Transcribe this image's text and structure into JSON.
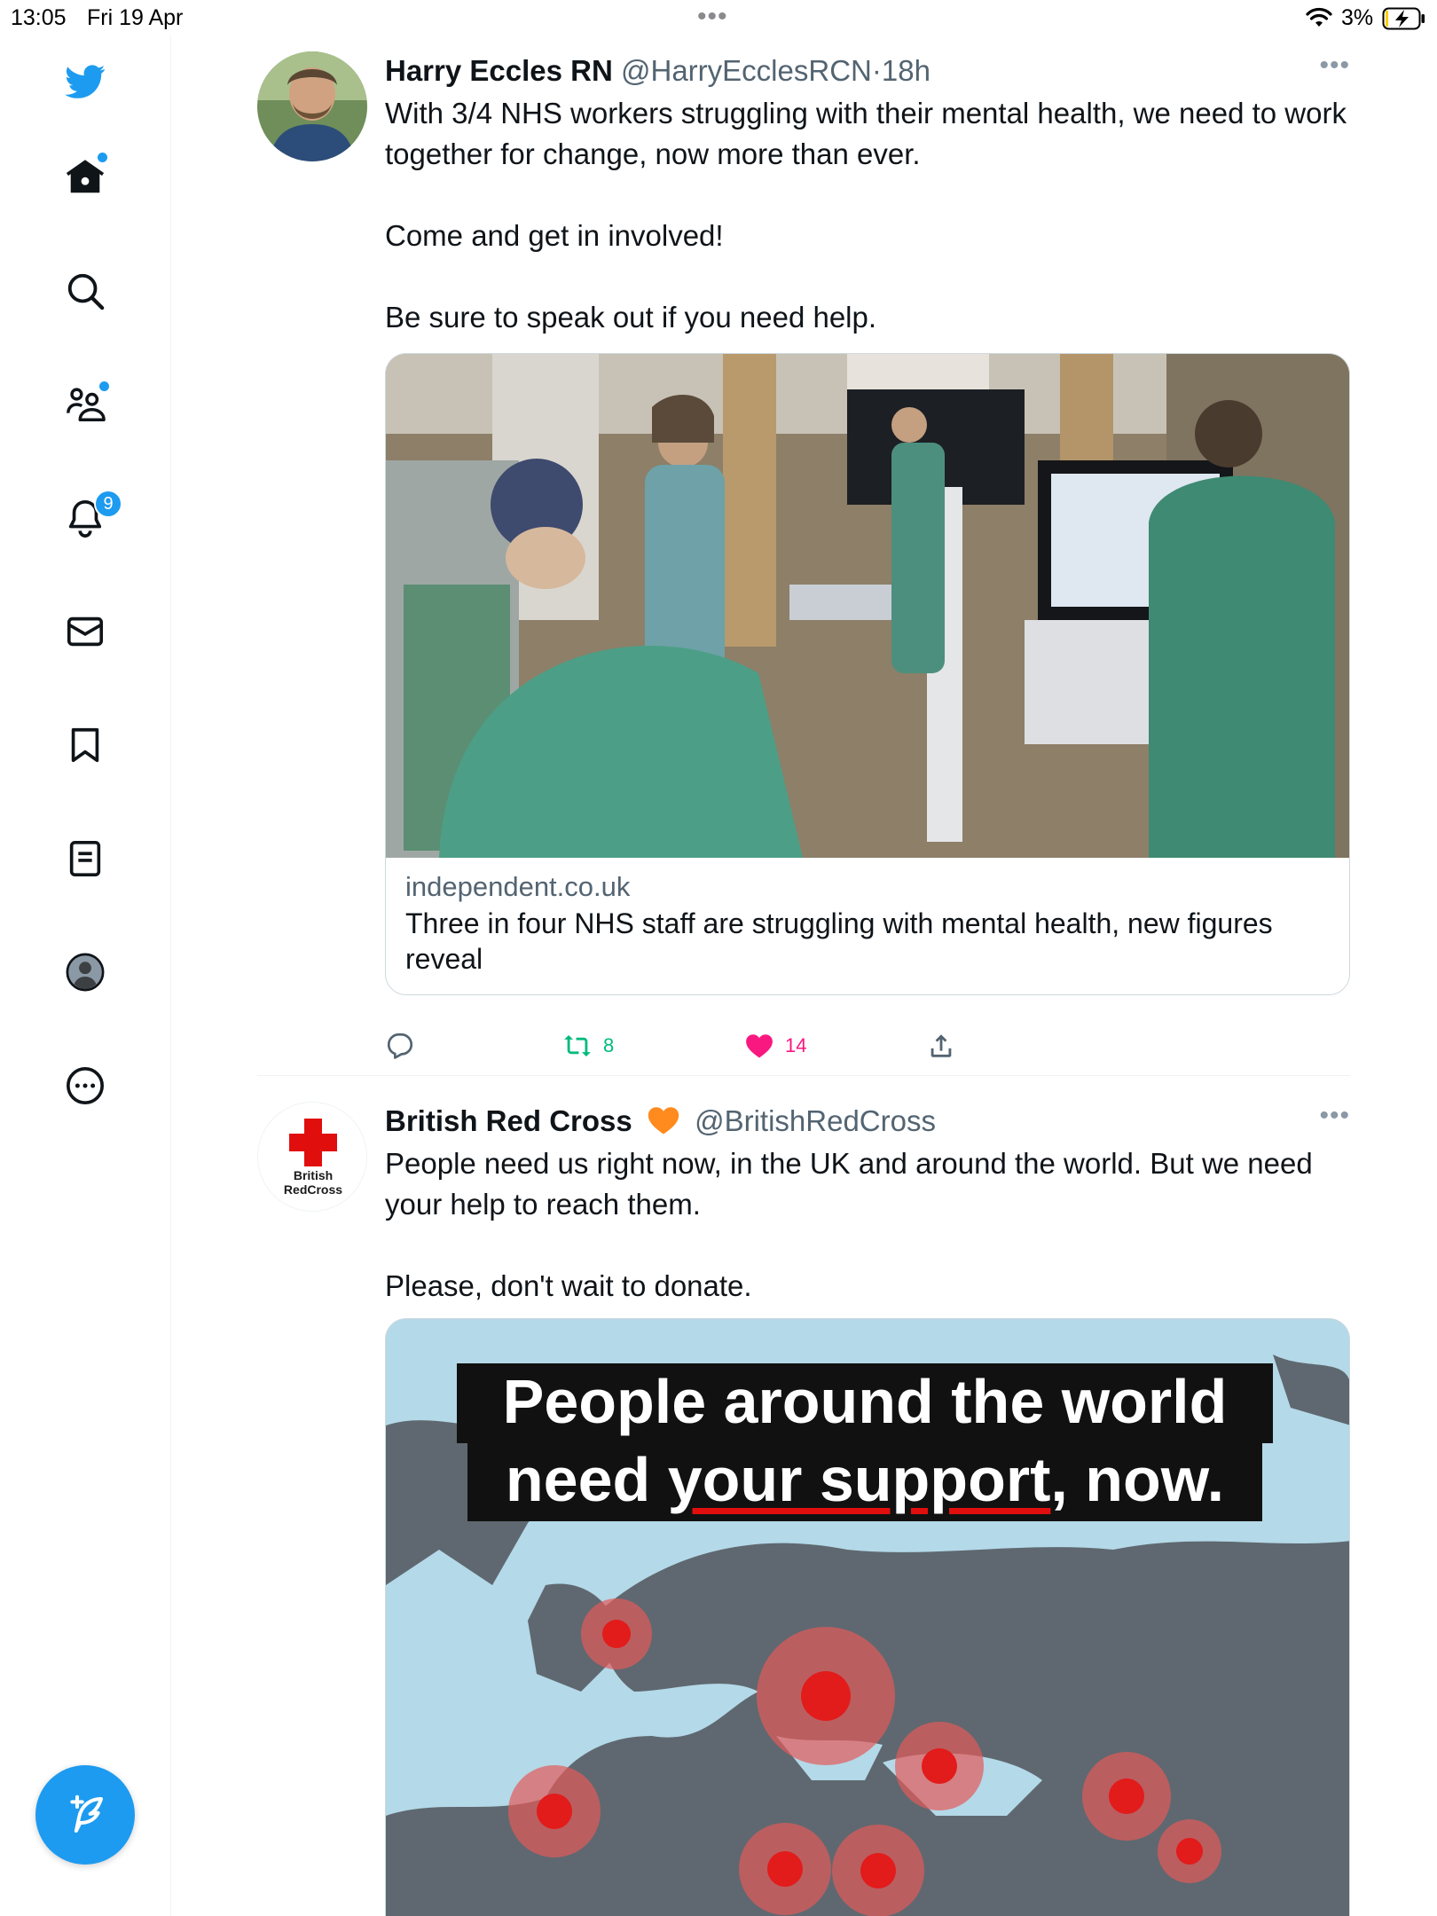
{
  "status_bar": {
    "time": "13:05",
    "date": "Fri 19 Apr",
    "battery": "3%"
  },
  "sidebar": {
    "notifications_count": "9",
    "items": [
      "home-icon",
      "search-icon",
      "communities-icon",
      "bell-icon",
      "mail-icon",
      "bookmark-icon",
      "lists-icon",
      "profile-icon",
      "more-icon"
    ]
  },
  "tweets": [
    {
      "name": "Harry Eccles RN",
      "handle": "@HarryEcclesRCN",
      "separator": "·",
      "time": "18h",
      "text": [
        "With 3/4 NHS workers struggling with their mental health, we need to work together for change, now more than ever.",
        "Come and get in involved!",
        "Be sure to speak out if you need help."
      ],
      "card": {
        "domain": "independent.co.uk",
        "title": "Three in four NHS staff are struggling with mental health, new figures reveal"
      },
      "retweets": "8",
      "likes": "14"
    },
    {
      "name": "British Red Cross",
      "handle": "@BritishRedCross",
      "avatar_text": [
        "British",
        "RedCross"
      ],
      "text": [
        "People need us right now, in the UK and around the world. But we need your help to reach them.",
        "Please, don't wait to donate."
      ],
      "image_banner": {
        "line1": "People around the world",
        "line2_before": "need ",
        "line2_underlined": "your support",
        "line2_after": ", now."
      }
    }
  ],
  "colors": {
    "accent": "#1d9bf0",
    "like": "#f91880",
    "retweet": "#00ba7c",
    "red_cross": "#e10e0e"
  }
}
